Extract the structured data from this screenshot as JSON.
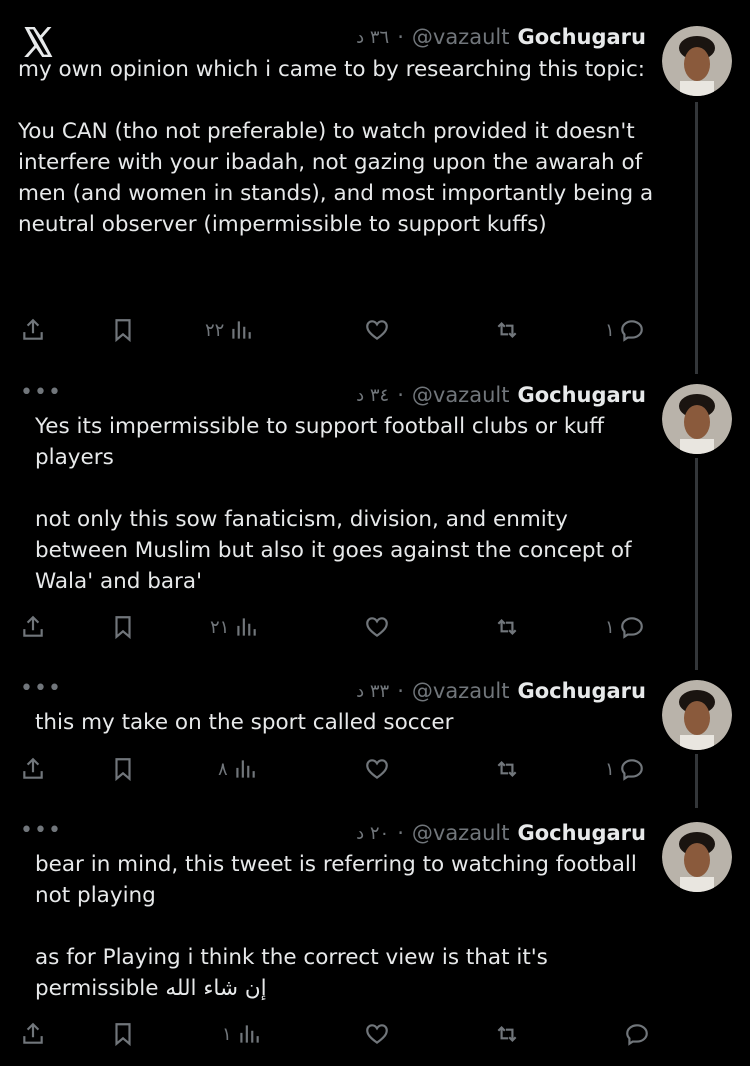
{
  "app": {
    "logo": "x-logo"
  },
  "tweets": [
    {
      "name": "Gochugaru",
      "handle": "@vazault",
      "time": "٣٦ د",
      "body": "my own opinion which i came to by researching this topic:\n\nYou CAN (tho not preferable) to watch provided it doesn't interfere with your ibadah, not gazing upon the awarah of men (and women in stands), and most importantly being a neutral observer (impermissible to support kuffs)",
      "views": "٢٢",
      "replies": "١"
    },
    {
      "name": "Gochugaru",
      "handle": "@vazault",
      "time": "٣٤ د",
      "body": "Yes its impermissible to support football clubs or kuff players\n\nnot only this sow fanaticism, division, and enmity between Muslim but also it goes against the concept of Wala' and bara'",
      "views": "٢١",
      "replies": "١"
    },
    {
      "name": "Gochugaru",
      "handle": "@vazault",
      "time": "٣٣ د",
      "body": "this my take on the sport called soccer",
      "views": "٨",
      "replies": "١"
    },
    {
      "name": "Gochugaru",
      "handle": "@vazault",
      "time": "٢٠ د",
      "body": "bear in mind, this tweet is referring to watching football not playing\n\nas for Playing i think the correct view is that it's permissible إن شاء الله",
      "views": "١",
      "replies": ""
    }
  ],
  "colors": {
    "background": "#000000",
    "text": "#e7e9ea",
    "muted": "#71767b",
    "thread_line": "#333639"
  }
}
